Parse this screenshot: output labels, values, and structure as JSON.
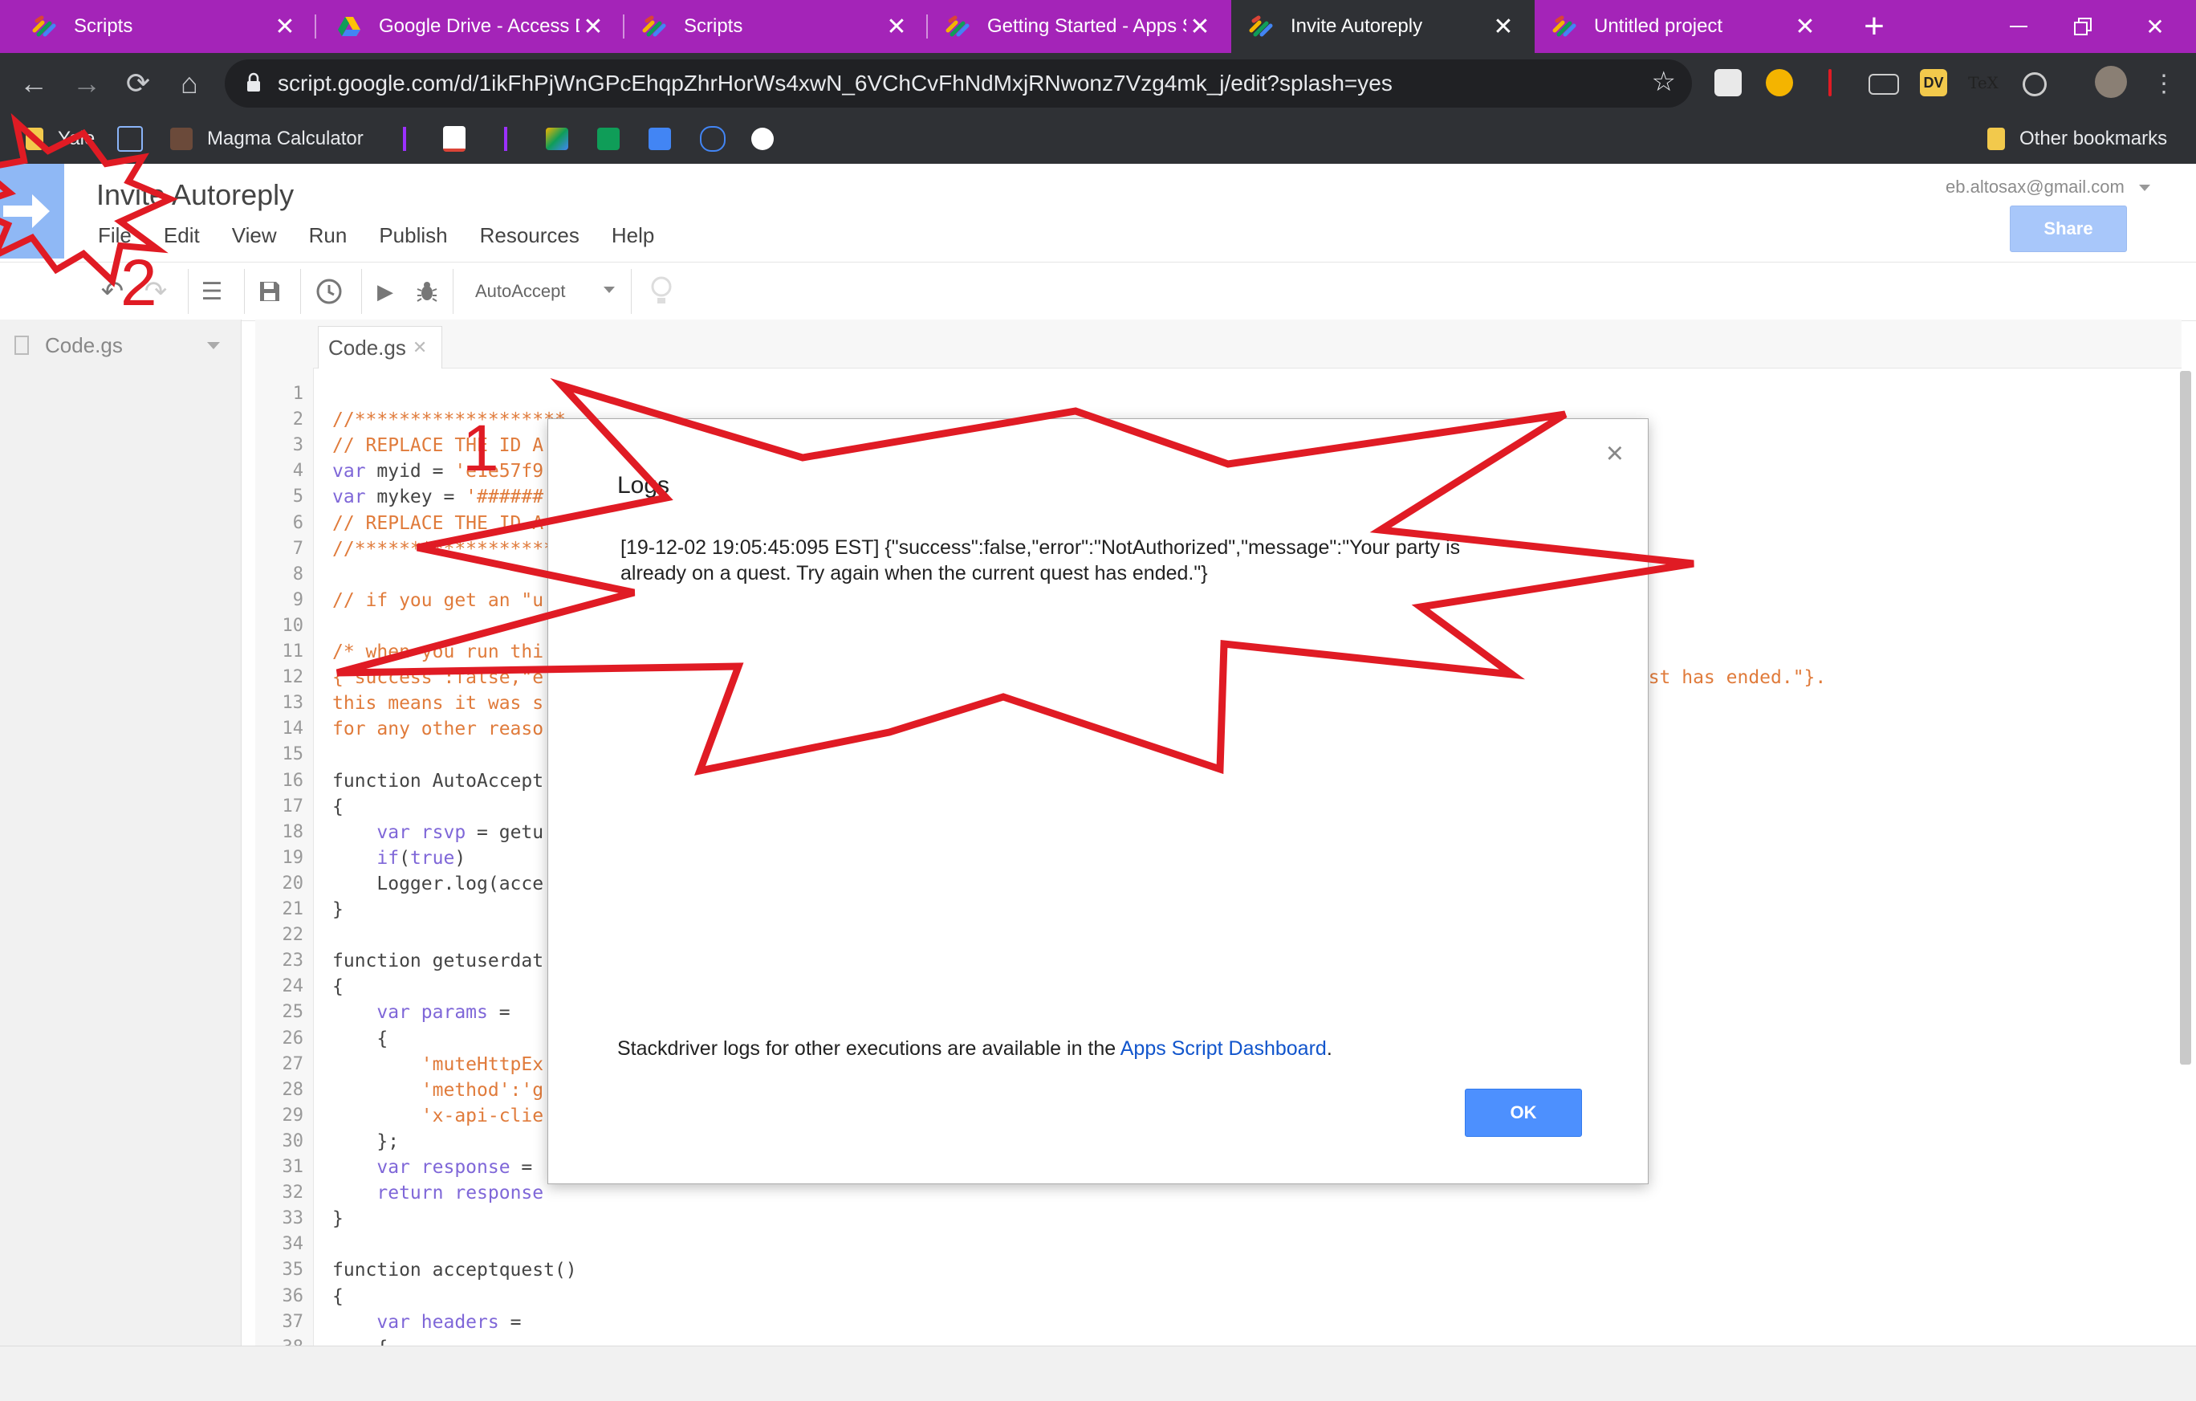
{
  "browser": {
    "tabs": [
      {
        "title": "Scripts",
        "active": false
      },
      {
        "title": "Google Drive - Access D",
        "active": false
      },
      {
        "title": "Scripts",
        "active": false
      },
      {
        "title": "Getting Started - Apps S",
        "active": false
      },
      {
        "title": "Invite Autoreply",
        "active": true
      },
      {
        "title": "Untitled project",
        "active": false
      }
    ],
    "new_tab_label": "+",
    "url": "script.google.com/d/1ikFhPjWnGPcEhqpZhrHorWs4xwN_6VChCvFhNdMxjRNwonz7Vzg4mk_j/edit?splash=yes",
    "bookmarks": [
      {
        "label": "Yale"
      },
      {
        "label": "Magma Calculator"
      }
    ],
    "other_bookmarks_label": "Other bookmarks",
    "ext_labels": {
      "dv": "DV",
      "tex": "TeX"
    }
  },
  "app": {
    "project_title": "Invite Autoreply",
    "menu": [
      "File",
      "Edit",
      "View",
      "Run",
      "Publish",
      "Resources",
      "Help"
    ],
    "account": "eb.altosax@gmail.com",
    "share_label": "Share",
    "function_select": "AutoAccept",
    "file_pane_item": "Code.gs",
    "editor_tab": "Code.gs"
  },
  "code": {
    "lines": [
      {
        "n": "1",
        "text": "",
        "cls": ""
      },
      {
        "n": "2",
        "text": "//*******************",
        "cls": "cm"
      },
      {
        "n": "3",
        "text": "// REPLACE THE ID A",
        "cls": "cm"
      },
      {
        "n": "4",
        "text": "var myid = 'e1e57f9",
        "cls": "mix-var"
      },
      {
        "n": "5",
        "text": "var mykey = '######",
        "cls": "mix-var"
      },
      {
        "n": "6",
        "text": "// REPLACE THE ID A",
        "cls": "cm"
      },
      {
        "n": "7",
        "text": "//*******************",
        "cls": "cm"
      },
      {
        "n": "8",
        "text": "",
        "cls": ""
      },
      {
        "n": "9",
        "text": "// if you get an \"u",
        "cls": "cm"
      },
      {
        "n": "10",
        "text": "",
        "cls": ""
      },
      {
        "n": "11",
        "text": "/* when you run thi",
        "cls": "cm"
      },
      {
        "n": "12",
        "text": "{\"success\":false,\"e",
        "cls": "cm"
      },
      {
        "n": "13",
        "text": "this means it was s",
        "cls": "cm"
      },
      {
        "n": "14",
        "text": "for any other reaso",
        "cls": "cm"
      },
      {
        "n": "15",
        "text": "",
        "cls": ""
      },
      {
        "n": "16",
        "text": "function AutoAccept",
        "cls": "fn"
      },
      {
        "n": "17",
        "text": "{",
        "cls": ""
      },
      {
        "n": "18",
        "text": "    var rsvp = getu",
        "cls": "mix-var2"
      },
      {
        "n": "19",
        "text": "    if(true)",
        "cls": "mix-if"
      },
      {
        "n": "20",
        "text": "    Logger.log(acce",
        "cls": ""
      },
      {
        "n": "21",
        "text": "}",
        "cls": ""
      },
      {
        "n": "22",
        "text": "",
        "cls": ""
      },
      {
        "n": "23",
        "text": "function getuserdat",
        "cls": "fn"
      },
      {
        "n": "24",
        "text": "{",
        "cls": ""
      },
      {
        "n": "25",
        "text": "    var params =",
        "cls": "mix-var2"
      },
      {
        "n": "26",
        "text": "    {",
        "cls": ""
      },
      {
        "n": "27",
        "text": "        'muteHttpEx",
        "cls": "st"
      },
      {
        "n": "28",
        "text": "        'method':'g",
        "cls": "st"
      },
      {
        "n": "29",
        "text": "        'x-api-clie",
        "cls": "st"
      },
      {
        "n": "30",
        "text": "    };",
        "cls": ""
      },
      {
        "n": "31",
        "text": "    var response =",
        "cls": "mix-var2"
      },
      {
        "n": "32",
        "text": "    return response",
        "cls": "mix-ret"
      },
      {
        "n": "33",
        "text": "}",
        "cls": ""
      },
      {
        "n": "34",
        "text": "",
        "cls": ""
      },
      {
        "n": "35",
        "text": "function acceptquest()",
        "cls": "fn"
      },
      {
        "n": "36",
        "text": "{",
        "cls": ""
      },
      {
        "n": "37",
        "text": "    var headers =",
        "cls": "mix-var2"
      },
      {
        "n": "38",
        "text": "    {",
        "cls": ""
      }
    ],
    "line12_tail": "uest has ended.\"}."
  },
  "dialog": {
    "title": "Logs",
    "close_glyph": "×",
    "log_text": "[19-12-02 19:05:45:095 EST] {\"success\":false,\"error\":\"NotAuthorized\",\"message\":\"Your party is already on a quest. Try again when the current quest has ended.\"}",
    "footer_prefix": "Stackdriver logs for other executions are available in the ",
    "footer_link": "Apps Script Dashboard",
    "footer_suffix": ".",
    "ok_label": "OK"
  },
  "annotations": {
    "marker_1": "1",
    "marker_2": "2",
    "color": "#e01b24"
  }
}
